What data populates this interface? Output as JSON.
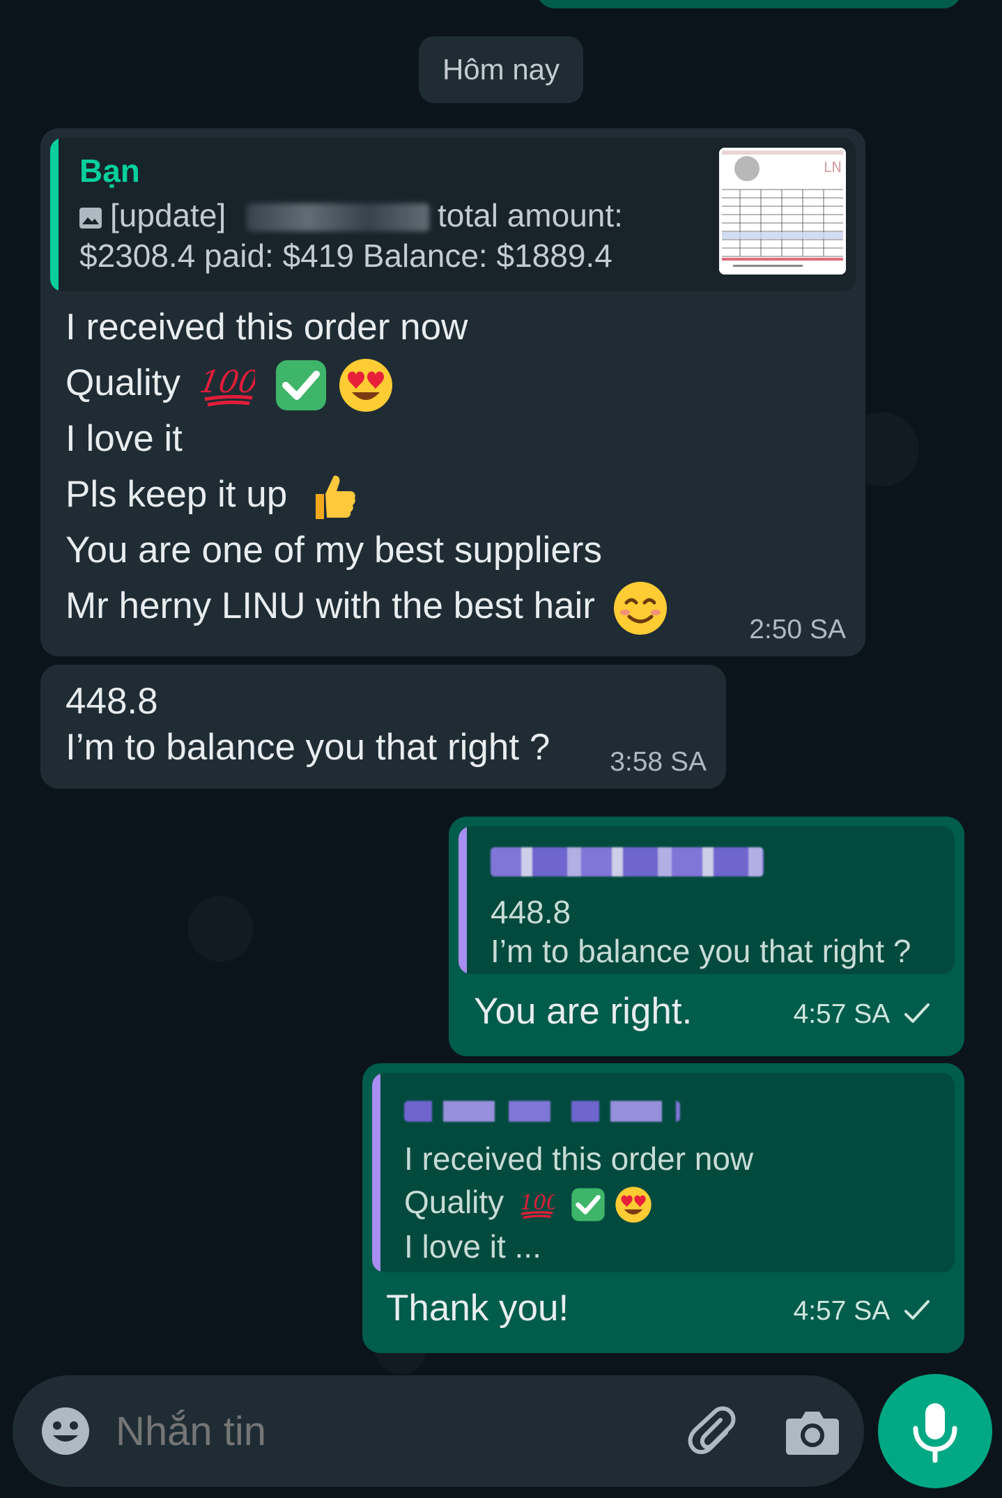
{
  "date_chip": "Hôm nay",
  "messages": [
    {
      "quote_author": "Bạn",
      "quote_line1_prefix": "[update]",
      "quote_line1_suffix": "total amount:",
      "quote_line2": "$2308.4 paid: $419 Balance: $1889.4",
      "lines": [
        "I received this order now",
        "Quality",
        "I love it",
        "Pls keep it up",
        "You are one of my best suppliers",
        "Mr herny LINU with the best hair"
      ],
      "time": "2:50 SA"
    },
    {
      "lines": [
        "448.8",
        "I’m to balance you that right ?"
      ],
      "time": "3:58 SA"
    },
    {
      "quote_line1": "448.8",
      "quote_line2": "I’m to balance you that right ?",
      "text": "You are right.",
      "time": "4:57 SA"
    },
    {
      "quote_line1": "I received this order now",
      "quote_line2": "Quality",
      "quote_line3": "I love it ...",
      "text": "Thank you!",
      "time": "4:57 SA"
    }
  ],
  "composer": {
    "placeholder": "Nhắn tin"
  },
  "colors": {
    "incoming_bubble": "#1f2c34",
    "outgoing_bubble": "#005c4b",
    "accent": "#00a884",
    "quote_author": "#06cf9c"
  }
}
